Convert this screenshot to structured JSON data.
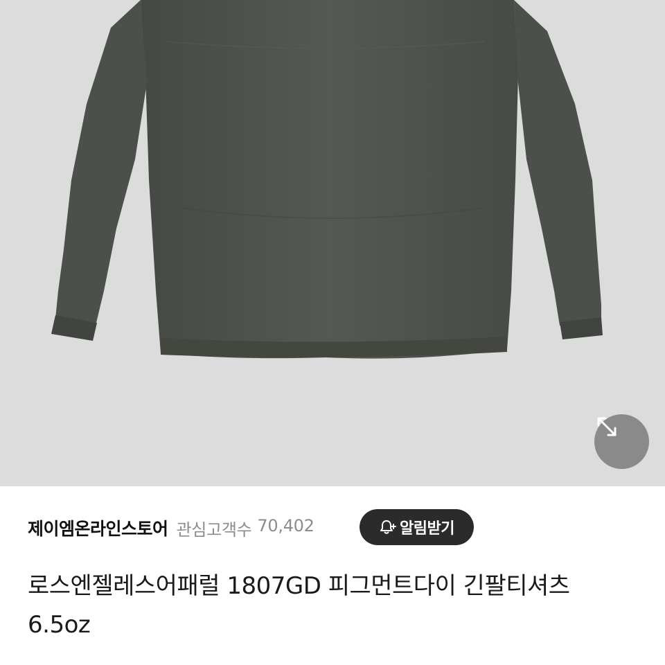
{
  "product_image": {
    "icon": "long-sleeve-tshirt-photo",
    "background": "#dcdcdc",
    "garment_color": "#4b4f4a"
  },
  "expand_button": {
    "icon": "expand-arrows-icon"
  },
  "store": {
    "name": "제이엠온라인스토어",
    "followers_label": "관심고객수",
    "followers_count": "70,402"
  },
  "notify_button": {
    "icon": "bell-plus-icon",
    "label": "알림받기"
  },
  "product": {
    "title": "로스엔젤레스어패럴 1807GD 피그먼트다이 긴팔티셔츠 6.5oz"
  }
}
